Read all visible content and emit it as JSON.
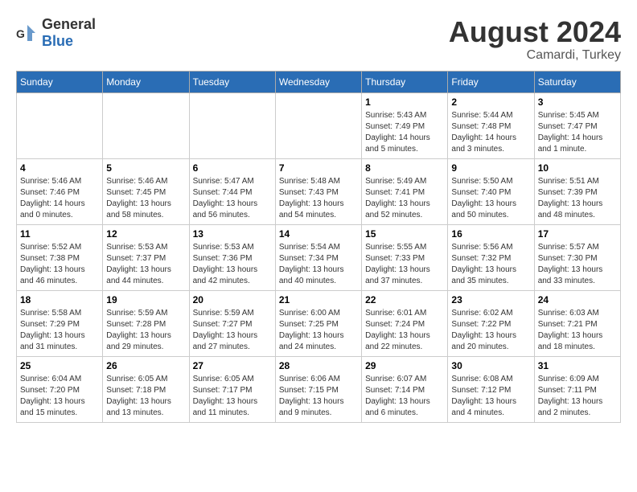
{
  "header": {
    "logo_general": "General",
    "logo_blue": "Blue",
    "month_year": "August 2024",
    "location": "Camardi, Turkey"
  },
  "days_of_week": [
    "Sunday",
    "Monday",
    "Tuesday",
    "Wednesday",
    "Thursday",
    "Friday",
    "Saturday"
  ],
  "weeks": [
    [
      {
        "day": "",
        "info": ""
      },
      {
        "day": "",
        "info": ""
      },
      {
        "day": "",
        "info": ""
      },
      {
        "day": "",
        "info": ""
      },
      {
        "day": "1",
        "info": "Sunrise: 5:43 AM\nSunset: 7:49 PM\nDaylight: 14 hours and 5 minutes."
      },
      {
        "day": "2",
        "info": "Sunrise: 5:44 AM\nSunset: 7:48 PM\nDaylight: 14 hours and 3 minutes."
      },
      {
        "day": "3",
        "info": "Sunrise: 5:45 AM\nSunset: 7:47 PM\nDaylight: 14 hours and 1 minute."
      }
    ],
    [
      {
        "day": "4",
        "info": "Sunrise: 5:46 AM\nSunset: 7:46 PM\nDaylight: 14 hours and 0 minutes."
      },
      {
        "day": "5",
        "info": "Sunrise: 5:46 AM\nSunset: 7:45 PM\nDaylight: 13 hours and 58 minutes."
      },
      {
        "day": "6",
        "info": "Sunrise: 5:47 AM\nSunset: 7:44 PM\nDaylight: 13 hours and 56 minutes."
      },
      {
        "day": "7",
        "info": "Sunrise: 5:48 AM\nSunset: 7:43 PM\nDaylight: 13 hours and 54 minutes."
      },
      {
        "day": "8",
        "info": "Sunrise: 5:49 AM\nSunset: 7:41 PM\nDaylight: 13 hours and 52 minutes."
      },
      {
        "day": "9",
        "info": "Sunrise: 5:50 AM\nSunset: 7:40 PM\nDaylight: 13 hours and 50 minutes."
      },
      {
        "day": "10",
        "info": "Sunrise: 5:51 AM\nSunset: 7:39 PM\nDaylight: 13 hours and 48 minutes."
      }
    ],
    [
      {
        "day": "11",
        "info": "Sunrise: 5:52 AM\nSunset: 7:38 PM\nDaylight: 13 hours and 46 minutes."
      },
      {
        "day": "12",
        "info": "Sunrise: 5:53 AM\nSunset: 7:37 PM\nDaylight: 13 hours and 44 minutes."
      },
      {
        "day": "13",
        "info": "Sunrise: 5:53 AM\nSunset: 7:36 PM\nDaylight: 13 hours and 42 minutes."
      },
      {
        "day": "14",
        "info": "Sunrise: 5:54 AM\nSunset: 7:34 PM\nDaylight: 13 hours and 40 minutes."
      },
      {
        "day": "15",
        "info": "Sunrise: 5:55 AM\nSunset: 7:33 PM\nDaylight: 13 hours and 37 minutes."
      },
      {
        "day": "16",
        "info": "Sunrise: 5:56 AM\nSunset: 7:32 PM\nDaylight: 13 hours and 35 minutes."
      },
      {
        "day": "17",
        "info": "Sunrise: 5:57 AM\nSunset: 7:30 PM\nDaylight: 13 hours and 33 minutes."
      }
    ],
    [
      {
        "day": "18",
        "info": "Sunrise: 5:58 AM\nSunset: 7:29 PM\nDaylight: 13 hours and 31 minutes."
      },
      {
        "day": "19",
        "info": "Sunrise: 5:59 AM\nSunset: 7:28 PM\nDaylight: 13 hours and 29 minutes."
      },
      {
        "day": "20",
        "info": "Sunrise: 5:59 AM\nSunset: 7:27 PM\nDaylight: 13 hours and 27 minutes."
      },
      {
        "day": "21",
        "info": "Sunrise: 6:00 AM\nSunset: 7:25 PM\nDaylight: 13 hours and 24 minutes."
      },
      {
        "day": "22",
        "info": "Sunrise: 6:01 AM\nSunset: 7:24 PM\nDaylight: 13 hours and 22 minutes."
      },
      {
        "day": "23",
        "info": "Sunrise: 6:02 AM\nSunset: 7:22 PM\nDaylight: 13 hours and 20 minutes."
      },
      {
        "day": "24",
        "info": "Sunrise: 6:03 AM\nSunset: 7:21 PM\nDaylight: 13 hours and 18 minutes."
      }
    ],
    [
      {
        "day": "25",
        "info": "Sunrise: 6:04 AM\nSunset: 7:20 PM\nDaylight: 13 hours and 15 minutes."
      },
      {
        "day": "26",
        "info": "Sunrise: 6:05 AM\nSunset: 7:18 PM\nDaylight: 13 hours and 13 minutes."
      },
      {
        "day": "27",
        "info": "Sunrise: 6:05 AM\nSunset: 7:17 PM\nDaylight: 13 hours and 11 minutes."
      },
      {
        "day": "28",
        "info": "Sunrise: 6:06 AM\nSunset: 7:15 PM\nDaylight: 13 hours and 9 minutes."
      },
      {
        "day": "29",
        "info": "Sunrise: 6:07 AM\nSunset: 7:14 PM\nDaylight: 13 hours and 6 minutes."
      },
      {
        "day": "30",
        "info": "Sunrise: 6:08 AM\nSunset: 7:12 PM\nDaylight: 13 hours and 4 minutes."
      },
      {
        "day": "31",
        "info": "Sunrise: 6:09 AM\nSunset: 7:11 PM\nDaylight: 13 hours and 2 minutes."
      }
    ]
  ]
}
